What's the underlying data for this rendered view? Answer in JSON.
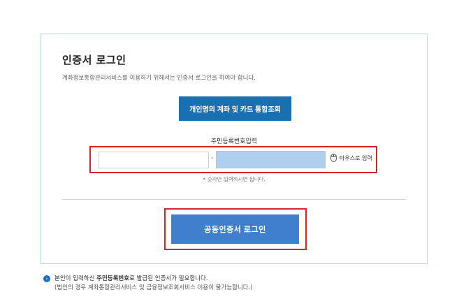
{
  "login": {
    "title": "인증서 로그인",
    "subtitle": "계좌정보통합관리서비스를 이용하기 위해서는 인증서 로그인을 하여야 합니다.",
    "integrated_button": "개인명의 계좌 및 카드 통합조회",
    "rrn_label": "주민등록번호입력",
    "rrn_front_value": "",
    "rrn_dash": "-",
    "mouse_input_label": "마우스로 입력",
    "hint": "• 숫자만 입력하시면 됩니다.",
    "login_button": "공동인증서 로그인"
  },
  "notice": {
    "line1_prefix": "본인이 입력하신 ",
    "line1_bold": "주민등록번호",
    "line1_suffix": "로 발급된 인증서가 필요합니다.",
    "line2": "(법인의 경우 계좌통합관리서비스 및 금융정보조회서비스 이용이 불가능합니다.)"
  },
  "colors": {
    "primary_button": "#1a6fb0",
    "login_button": "#3f7fcb",
    "highlight_border": "#d7262a",
    "masked_field": "#aecfee"
  }
}
